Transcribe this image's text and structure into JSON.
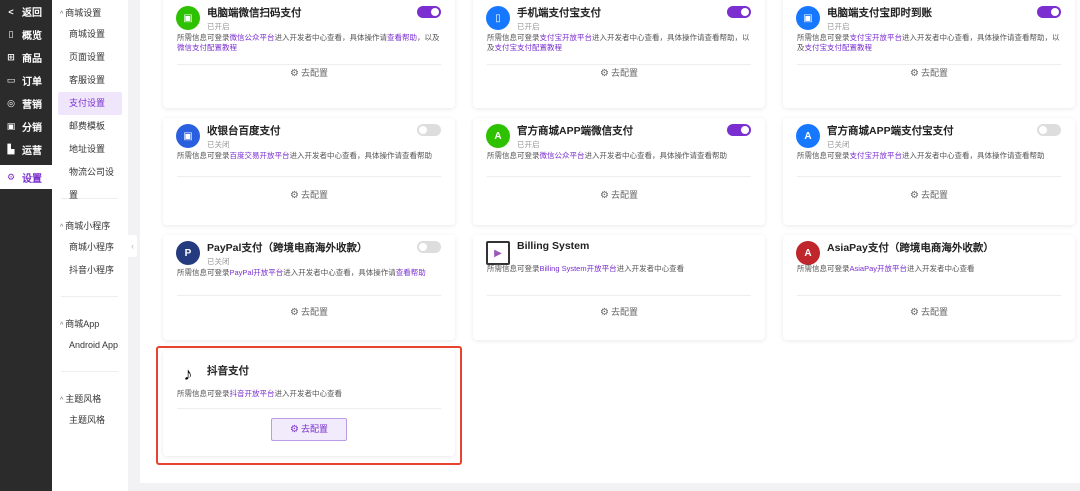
{
  "nav": [
    {
      "icon": "<",
      "label": "返回"
    },
    {
      "icon": "▯",
      "label": "概览"
    },
    {
      "icon": "⊞",
      "label": "商品"
    },
    {
      "icon": "▭",
      "label": "订单"
    },
    {
      "icon": "◎",
      "label": "营销"
    },
    {
      "icon": "▣",
      "label": "分销"
    },
    {
      "icon": "▙",
      "label": "运营"
    },
    {
      "icon": "⚙",
      "label": "设置"
    }
  ],
  "submenu": [
    {
      "title": "商城设置",
      "items": [
        "商城设置",
        "页面设置",
        "客服设置",
        "支付设置",
        "邮费模板",
        "地址设置",
        "物流公司设置"
      ]
    },
    {
      "title": "商城小程序",
      "items": [
        "商城小程序",
        "抖音小程序"
      ]
    },
    {
      "title": "商城App",
      "items": [
        "Android App"
      ]
    },
    {
      "title": "主题风格",
      "items": [
        "主题风格"
      ]
    }
  ],
  "active_submenu": "支付设置",
  "collapse_icon": "‹",
  "config_label": "去配置",
  "cards": [
    {
      "title": "电脑端微信扫码支付",
      "status": "已开启",
      "enabled": true,
      "icon": "wechat-pc",
      "color": "#2dc100",
      "desc": [
        {
          "t": "所需信息可登录"
        },
        {
          "t": "微信公众平台",
          "link": true
        },
        {
          "t": "进入开发者中心查看，具体操作请"
        },
        {
          "t": "查看帮助",
          "link": true
        },
        {
          "t": "，以及"
        },
        {
          "t": "微信支付配置教程",
          "link": true
        }
      ]
    },
    {
      "title": "手机端支付宝支付",
      "status": "已开启",
      "enabled": true,
      "icon": "alipay-mobile",
      "color": "#1677ff",
      "desc": [
        {
          "t": "所需信息可登录"
        },
        {
          "t": "支付宝开放平台",
          "link": true
        },
        {
          "t": "进入开发者中心查看，具体操作请查看帮助，以及"
        },
        {
          "t": "支付宝支付配置教程",
          "link": true
        }
      ]
    },
    {
      "title": "电脑端支付宝即时到账",
      "status": "已开启",
      "enabled": true,
      "icon": "alipay-pc",
      "color": "#1677ff",
      "desc": [
        {
          "t": "所需信息可登录"
        },
        {
          "t": "支付宝开放平台",
          "link": true
        },
        {
          "t": "进入开发者中心查看，具体操作请查看帮助，以及"
        },
        {
          "t": "支付宝支付配置教程",
          "link": true
        }
      ]
    },
    {
      "title": "收银台百度支付",
      "status": "已关闭",
      "enabled": false,
      "icon": "baidu",
      "color": "#2a5fe0",
      "desc": [
        {
          "t": "所需信息可登录"
        },
        {
          "t": "百度交易开放平台",
          "link": true
        },
        {
          "t": "进入开发者中心查看，具体操作请查看帮助"
        }
      ]
    },
    {
      "title": "官方商城APP端微信支付",
      "status": "已开启",
      "enabled": true,
      "icon": "wechat-app",
      "color": "#2dc100",
      "desc": [
        {
          "t": "所需信息可登录"
        },
        {
          "t": "微信公众平台",
          "link": true
        },
        {
          "t": "进入开发者中心查看，具体操作请查看帮助"
        }
      ]
    },
    {
      "title": "官方商城APP端支付宝支付",
      "status": "已关闭",
      "enabled": false,
      "icon": "alipay-app",
      "color": "#1677ff",
      "desc": [
        {
          "t": "所需信息可登录"
        },
        {
          "t": "支付宝开放平台",
          "link": true
        },
        {
          "t": "进入开发者中心查看，具体操作请查看帮助"
        }
      ]
    },
    {
      "title": "PayPal支付（跨境电商海外收款）",
      "status": "已关闭",
      "enabled": false,
      "icon": "paypal",
      "color": "#253b80",
      "desc": [
        {
          "t": "所需信息可登录"
        },
        {
          "t": "PayPal开放平台",
          "link": true
        },
        {
          "t": "进入开发者中心查看，具体操作请"
        },
        {
          "t": "查看帮助",
          "link": true
        }
      ]
    },
    {
      "title": "Billing System",
      "icon": "billing",
      "color": "#9b59b6",
      "desc": [
        {
          "t": "所需信息可登录"
        },
        {
          "t": "Billing System开放平台",
          "link": true
        },
        {
          "t": "进入开发者中心查看"
        }
      ]
    },
    {
      "title": "AsiaPay支付（跨境电商海外收款）",
      "icon": "asiapay",
      "color": "#c0272d",
      "desc": [
        {
          "t": "所需信息可登录"
        },
        {
          "t": "AsiaPay开放平台",
          "link": true
        },
        {
          "t": "进入开发者中心查看"
        }
      ]
    },
    {
      "title": "抖音支付",
      "icon": "douyin",
      "color": "#000000",
      "highlighted": true,
      "desc": [
        {
          "t": "所需信息可登录"
        },
        {
          "t": "抖音开放平台",
          "link": true
        },
        {
          "t": "进入开发者中心查看"
        }
      ]
    }
  ]
}
